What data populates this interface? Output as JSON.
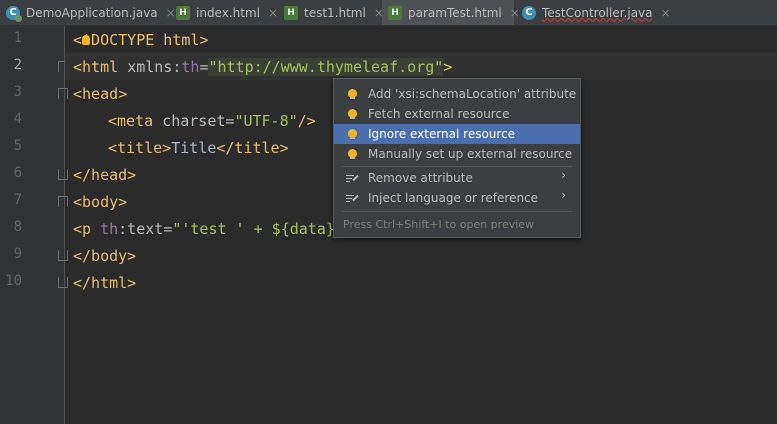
{
  "tabs": [
    {
      "label": "DemoApplication.java",
      "icon": "spring-class-icon"
    },
    {
      "label": "index.html",
      "icon": "html-file-icon"
    },
    {
      "label": "test1.html",
      "icon": "html-file-icon"
    },
    {
      "label": "paramTest.html",
      "icon": "html-file-icon",
      "active": true
    },
    {
      "label": "TestController.java",
      "icon": "class-icon"
    }
  ],
  "close_glyph": "×",
  "line_numbers": [
    "1",
    "2",
    "3",
    "4",
    "5",
    "6",
    "7",
    "8",
    "9",
    "10"
  ],
  "code": {
    "l1": {
      "a": "<",
      "b": "!DOCTYPE html",
      "c": ">"
    },
    "l2": {
      "open": "<html ",
      "attr": "xmlns:",
      "ns": "th",
      "eq": "=",
      "url": "\"http://www.thymeleaf.org\"",
      "close": ">"
    },
    "l3": "<head>",
    "l4": {
      "open": "<meta ",
      "attr": "charset",
      "eq": "=",
      "val": "\"UTF-8\"",
      "close": "/>"
    },
    "l5": {
      "open": "<title>",
      "text": "Title",
      "close": "</title>"
    },
    "l6": "</head>",
    "l7": "<body>",
    "l8": {
      "open": "<p ",
      "ns": "th",
      "attr": ":text",
      "eq": "=",
      "val": "\"'test ' + ${data}"
    },
    "l9": "</body>",
    "l10": "</html>"
  },
  "popup": {
    "items": [
      {
        "label": "Add 'xsi:schemaLocation' attribute",
        "icon": "bulb-icon"
      },
      {
        "label": "Fetch external resource",
        "icon": "bulb-icon"
      },
      {
        "label": "Ignore external resource",
        "icon": "bulb-icon",
        "selected": true
      },
      {
        "label": "Manually set up external resource",
        "icon": "bulb-icon"
      },
      {
        "label": "Remove attribute",
        "icon": "edit-icon",
        "submenu": true
      },
      {
        "label": "Inject language or reference",
        "icon": "edit-icon",
        "submenu": true
      }
    ],
    "submenu_arrow": "›",
    "footer": "Press Ctrl+Shift+I to open preview"
  },
  "colors": {
    "accent": "#4b6eaf",
    "tag": "#e8bf6a",
    "string": "#a5c25c",
    "namespace": "#9876aa"
  }
}
